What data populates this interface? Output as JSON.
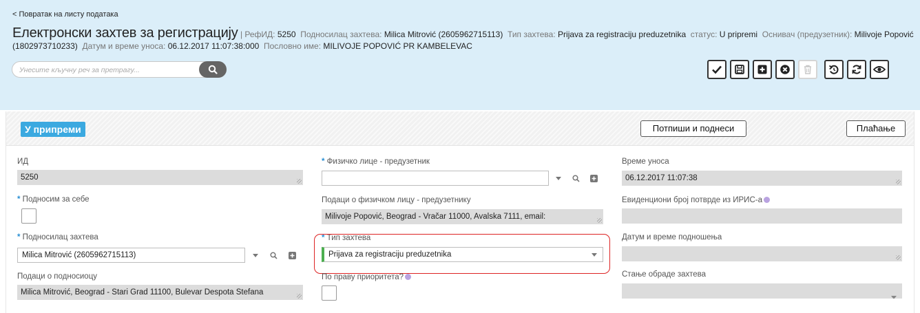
{
  "nav": {
    "back_link": "< Повратак на листу података"
  },
  "header": {
    "title": "Електронски захтев за регистрацију",
    "refid_label": "| РефИД:",
    "refid_value": "5250",
    "submitter_label": "Подносилац захтева:",
    "submitter_value": "Milica Mitrović (2605962715113)",
    "request_type_label": "Тип захтева:",
    "request_type_value": "Prijava za registraciju preduzetnika",
    "status_label": "статус:",
    "status_value": "U pripremi",
    "founder_label": "Оснивач (предузетник):",
    "founder_value": "Milivoje Popović (1802973710233)",
    "entry_time_label": "Датум и време уноса:",
    "entry_time_value": "06.12.2017 11:07:38:000",
    "business_name_label": "Пословно име:",
    "business_name_value": "MILIVOJE POPOVIĆ PR KAMBELEVAC"
  },
  "search": {
    "placeholder": "Унесите кључну реч за претрагу...",
    "icon": "search-icon"
  },
  "toolbar": {
    "icons": [
      "check-icon",
      "save-icon",
      "plus-icon",
      "close-circle-icon",
      "trash-icon",
      "undo-icon",
      "refresh-icon",
      "eye-icon"
    ]
  },
  "panel": {
    "status_badge": "У припреми",
    "sign_submit_button": "Потпиши и поднеси",
    "payment_button": "Плаћање"
  },
  "form": {
    "id_label": "ИД",
    "id_value": "5250",
    "submit_for_self_label": "Подносим за себе",
    "submitter_label": "Подносилац захтева",
    "submitter_value": "Milica Mitrović (2605962715113)",
    "submitter_data_label": "Подаци о подносиоцу",
    "submitter_data_value": "Milica Mitrović, Beograd - Stari Grad 11100, Bulevar Despota Stefana",
    "natural_person_label": "Физичко лице - предузетник",
    "natural_person_value": "",
    "natural_person_data_label": "Подаци о физичком лицу - предузетнику",
    "natural_person_data_value": "Milivoje Popović, Beograd - Vračar 11000, Avalska 7111, email:",
    "request_type_label": "Тип захтева",
    "request_type_value": "Prijava za registraciju preduzetnika",
    "priority_label": "По праву приоритета?",
    "entry_time_label": "Време уноса",
    "entry_time_value": "06.12.2017 11:07:38",
    "iris_number_label": "Евиденциони број потврде из ИРИС-а",
    "iris_number_value": "",
    "submission_time_label": "Датум и време подношења",
    "submission_time_value": "",
    "processing_state_label": "Стање обраде захтева",
    "processing_state_value": ""
  },
  "colors": {
    "header_bg": "#dbeef9",
    "badge_bg": "#3ba9e0",
    "required_star": "#2a8fd4",
    "highlight": "#dd2222",
    "valid_marker": "#4caf50"
  }
}
